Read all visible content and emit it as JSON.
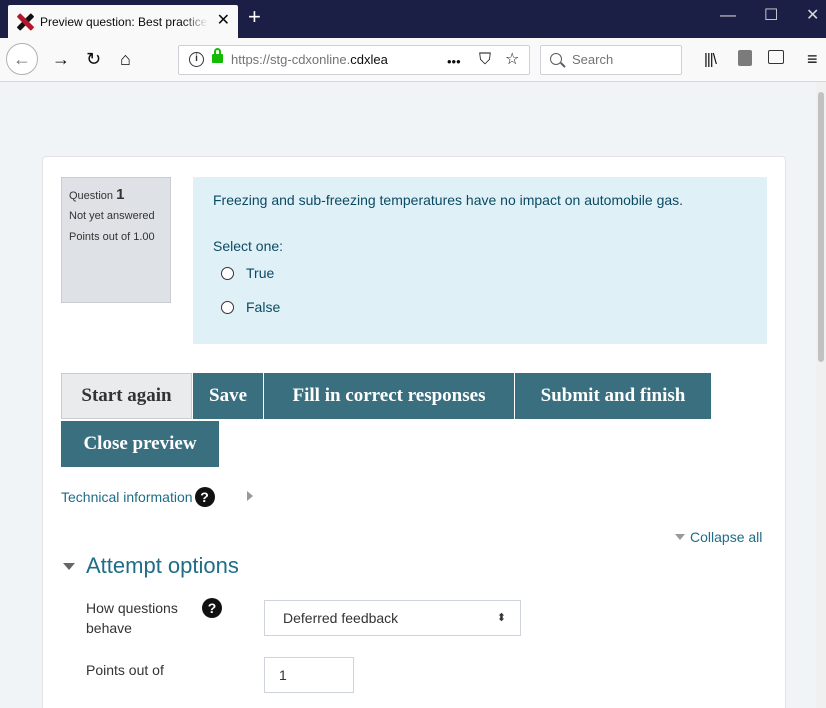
{
  "browser": {
    "tab_title": "Preview question: Best practice",
    "tab_close": "✕",
    "new_tab": "+",
    "url": "https://stg-cdxonline.cdxlea",
    "url_host_bold": "cdxlea",
    "url_prefix": "https://stg-cdxonline.",
    "url_more": "•••",
    "search_placeholder": "Search",
    "window_controls": {
      "minimize": "—",
      "maximize": "☐",
      "close": "✕"
    }
  },
  "question": {
    "label": "Question",
    "number": "1",
    "state": "Not yet answered",
    "points": "Points out of 1.00",
    "text": "Freezing and sub-freezing temperatures have no impact on automobile gas.",
    "prompt": "Select one:",
    "options": [
      "True",
      "False"
    ]
  },
  "buttons": {
    "start_again": "Start again",
    "save": "Save",
    "fill_correct": "Fill in correct responses",
    "submit_finish": "Submit and finish",
    "close_preview": "Close preview"
  },
  "technical_information": "Technical information",
  "help_symbol": "?",
  "collapse_all": "Collapse all",
  "attempt_options": {
    "heading": "Attempt options",
    "how_questions_behave_label": "How questions behave",
    "how_questions_behave_value": "Deferred feedback",
    "select_arrows": "⬍",
    "points_out_of_label": "Points out of",
    "points_out_of_value": "1"
  },
  "colors": {
    "browser_titlebar": "#1c1f45",
    "question_box": "#dff1f6",
    "primary_button": "#3a6f80",
    "link": "#1f6d87"
  }
}
